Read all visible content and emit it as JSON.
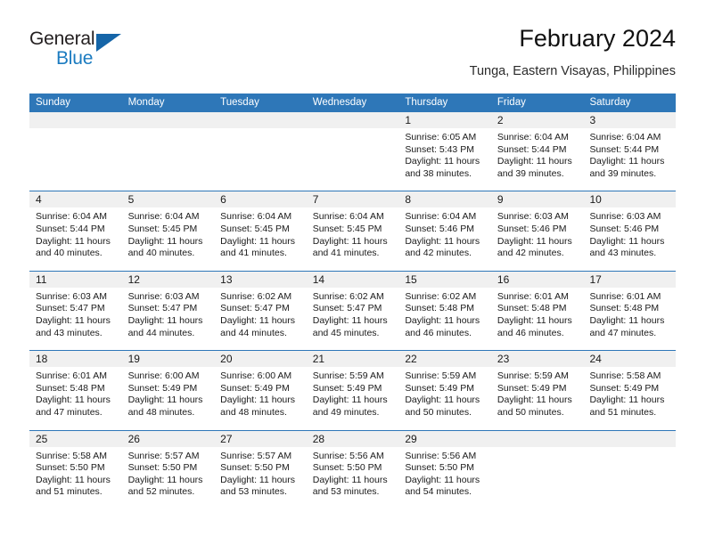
{
  "brand": {
    "name_top": "General",
    "name_bottom": "Blue",
    "triangle_color": "#1565a8"
  },
  "header": {
    "title": "February 2024",
    "subtitle": "Tunga, Eastern Visayas, Philippines"
  },
  "colors": {
    "header_blue": "#2e77b8",
    "daynum_gray": "#f0f0f0",
    "text": "#1a1a1a"
  },
  "weekdays": [
    "Sunday",
    "Monday",
    "Tuesday",
    "Wednesday",
    "Thursday",
    "Friday",
    "Saturday"
  ],
  "weeks": [
    [
      {
        "day": "",
        "sunrise": "",
        "sunset": "",
        "daylight1": "",
        "daylight2": ""
      },
      {
        "day": "",
        "sunrise": "",
        "sunset": "",
        "daylight1": "",
        "daylight2": ""
      },
      {
        "day": "",
        "sunrise": "",
        "sunset": "",
        "daylight1": "",
        "daylight2": ""
      },
      {
        "day": "",
        "sunrise": "",
        "sunset": "",
        "daylight1": "",
        "daylight2": ""
      },
      {
        "day": "1",
        "sunrise": "Sunrise: 6:05 AM",
        "sunset": "Sunset: 5:43 PM",
        "daylight1": "Daylight: 11 hours",
        "daylight2": "and 38 minutes."
      },
      {
        "day": "2",
        "sunrise": "Sunrise: 6:04 AM",
        "sunset": "Sunset: 5:44 PM",
        "daylight1": "Daylight: 11 hours",
        "daylight2": "and 39 minutes."
      },
      {
        "day": "3",
        "sunrise": "Sunrise: 6:04 AM",
        "sunset": "Sunset: 5:44 PM",
        "daylight1": "Daylight: 11 hours",
        "daylight2": "and 39 minutes."
      }
    ],
    [
      {
        "day": "4",
        "sunrise": "Sunrise: 6:04 AM",
        "sunset": "Sunset: 5:44 PM",
        "daylight1": "Daylight: 11 hours",
        "daylight2": "and 40 minutes."
      },
      {
        "day": "5",
        "sunrise": "Sunrise: 6:04 AM",
        "sunset": "Sunset: 5:45 PM",
        "daylight1": "Daylight: 11 hours",
        "daylight2": "and 40 minutes."
      },
      {
        "day": "6",
        "sunrise": "Sunrise: 6:04 AM",
        "sunset": "Sunset: 5:45 PM",
        "daylight1": "Daylight: 11 hours",
        "daylight2": "and 41 minutes."
      },
      {
        "day": "7",
        "sunrise": "Sunrise: 6:04 AM",
        "sunset": "Sunset: 5:45 PM",
        "daylight1": "Daylight: 11 hours",
        "daylight2": "and 41 minutes."
      },
      {
        "day": "8",
        "sunrise": "Sunrise: 6:04 AM",
        "sunset": "Sunset: 5:46 PM",
        "daylight1": "Daylight: 11 hours",
        "daylight2": "and 42 minutes."
      },
      {
        "day": "9",
        "sunrise": "Sunrise: 6:03 AM",
        "sunset": "Sunset: 5:46 PM",
        "daylight1": "Daylight: 11 hours",
        "daylight2": "and 42 minutes."
      },
      {
        "day": "10",
        "sunrise": "Sunrise: 6:03 AM",
        "sunset": "Sunset: 5:46 PM",
        "daylight1": "Daylight: 11 hours",
        "daylight2": "and 43 minutes."
      }
    ],
    [
      {
        "day": "11",
        "sunrise": "Sunrise: 6:03 AM",
        "sunset": "Sunset: 5:47 PM",
        "daylight1": "Daylight: 11 hours",
        "daylight2": "and 43 minutes."
      },
      {
        "day": "12",
        "sunrise": "Sunrise: 6:03 AM",
        "sunset": "Sunset: 5:47 PM",
        "daylight1": "Daylight: 11 hours",
        "daylight2": "and 44 minutes."
      },
      {
        "day": "13",
        "sunrise": "Sunrise: 6:02 AM",
        "sunset": "Sunset: 5:47 PM",
        "daylight1": "Daylight: 11 hours",
        "daylight2": "and 44 minutes."
      },
      {
        "day": "14",
        "sunrise": "Sunrise: 6:02 AM",
        "sunset": "Sunset: 5:47 PM",
        "daylight1": "Daylight: 11 hours",
        "daylight2": "and 45 minutes."
      },
      {
        "day": "15",
        "sunrise": "Sunrise: 6:02 AM",
        "sunset": "Sunset: 5:48 PM",
        "daylight1": "Daylight: 11 hours",
        "daylight2": "and 46 minutes."
      },
      {
        "day": "16",
        "sunrise": "Sunrise: 6:01 AM",
        "sunset": "Sunset: 5:48 PM",
        "daylight1": "Daylight: 11 hours",
        "daylight2": "and 46 minutes."
      },
      {
        "day": "17",
        "sunrise": "Sunrise: 6:01 AM",
        "sunset": "Sunset: 5:48 PM",
        "daylight1": "Daylight: 11 hours",
        "daylight2": "and 47 minutes."
      }
    ],
    [
      {
        "day": "18",
        "sunrise": "Sunrise: 6:01 AM",
        "sunset": "Sunset: 5:48 PM",
        "daylight1": "Daylight: 11 hours",
        "daylight2": "and 47 minutes."
      },
      {
        "day": "19",
        "sunrise": "Sunrise: 6:00 AM",
        "sunset": "Sunset: 5:49 PM",
        "daylight1": "Daylight: 11 hours",
        "daylight2": "and 48 minutes."
      },
      {
        "day": "20",
        "sunrise": "Sunrise: 6:00 AM",
        "sunset": "Sunset: 5:49 PM",
        "daylight1": "Daylight: 11 hours",
        "daylight2": "and 48 minutes."
      },
      {
        "day": "21",
        "sunrise": "Sunrise: 5:59 AM",
        "sunset": "Sunset: 5:49 PM",
        "daylight1": "Daylight: 11 hours",
        "daylight2": "and 49 minutes."
      },
      {
        "day": "22",
        "sunrise": "Sunrise: 5:59 AM",
        "sunset": "Sunset: 5:49 PM",
        "daylight1": "Daylight: 11 hours",
        "daylight2": "and 50 minutes."
      },
      {
        "day": "23",
        "sunrise": "Sunrise: 5:59 AM",
        "sunset": "Sunset: 5:49 PM",
        "daylight1": "Daylight: 11 hours",
        "daylight2": "and 50 minutes."
      },
      {
        "day": "24",
        "sunrise": "Sunrise: 5:58 AM",
        "sunset": "Sunset: 5:49 PM",
        "daylight1": "Daylight: 11 hours",
        "daylight2": "and 51 minutes."
      }
    ],
    [
      {
        "day": "25",
        "sunrise": "Sunrise: 5:58 AM",
        "sunset": "Sunset: 5:50 PM",
        "daylight1": "Daylight: 11 hours",
        "daylight2": "and 51 minutes."
      },
      {
        "day": "26",
        "sunrise": "Sunrise: 5:57 AM",
        "sunset": "Sunset: 5:50 PM",
        "daylight1": "Daylight: 11 hours",
        "daylight2": "and 52 minutes."
      },
      {
        "day": "27",
        "sunrise": "Sunrise: 5:57 AM",
        "sunset": "Sunset: 5:50 PM",
        "daylight1": "Daylight: 11 hours",
        "daylight2": "and 53 minutes."
      },
      {
        "day": "28",
        "sunrise": "Sunrise: 5:56 AM",
        "sunset": "Sunset: 5:50 PM",
        "daylight1": "Daylight: 11 hours",
        "daylight2": "and 53 minutes."
      },
      {
        "day": "29",
        "sunrise": "Sunrise: 5:56 AM",
        "sunset": "Sunset: 5:50 PM",
        "daylight1": "Daylight: 11 hours",
        "daylight2": "and 54 minutes."
      },
      {
        "day": "",
        "sunrise": "",
        "sunset": "",
        "daylight1": "",
        "daylight2": ""
      },
      {
        "day": "",
        "sunrise": "",
        "sunset": "",
        "daylight1": "",
        "daylight2": ""
      }
    ]
  ]
}
